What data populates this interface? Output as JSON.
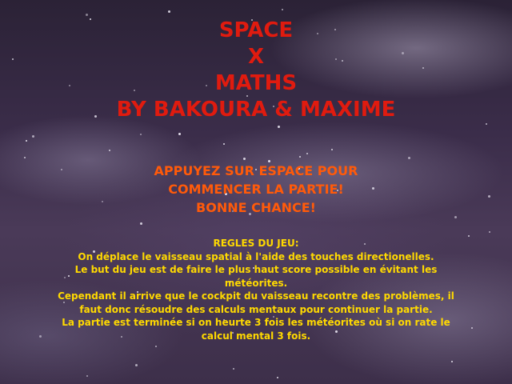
{
  "title": {
    "line1": "SPACE",
    "line2": "X",
    "line3": "MATHS",
    "line4": "BY BAKOURA & MAXIME"
  },
  "prompt": {
    "line1": "APPUYEZ SUR ESPACE POUR",
    "line2": "COMMENCER LA PARTIE!",
    "line3": "BONNE CHANCE!"
  },
  "rules": {
    "heading": "REGLES DU JEU:",
    "line1": "On déplace le vaisseau spatial à l'aide des touches directionelles.",
    "line2": "Le but du jeu est de faire le plus haut score possible en évitant les",
    "line3": "météorites.",
    "line4": "Cependant il arrive que le cockpit du vaisseau recontre des problèmes, il",
    "line5": "faut donc résoudre des calculs mentaux pour continuer la partie.",
    "line6": "La partie est terminée si on heurte 3 fois les météorites où si on rate le",
    "line7": "calcul mental 3 fois."
  },
  "colors": {
    "title": "#e01b0f",
    "prompt": "#ff5a0a",
    "rules": "#ffd900"
  }
}
